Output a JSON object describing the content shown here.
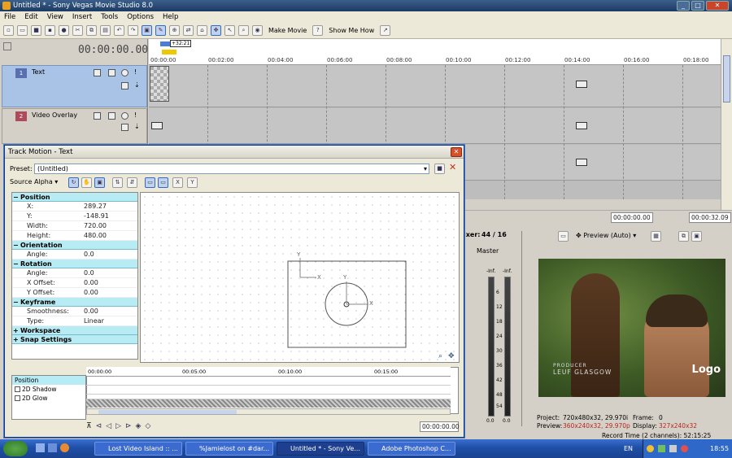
{
  "window": {
    "title": "Untitled * - Sony Vegas Movie Studio 8.0"
  },
  "menu": [
    "File",
    "Edit",
    "View",
    "Insert",
    "Tools",
    "Options",
    "Help"
  ],
  "toolbar": {
    "make_movie": "Make Movie",
    "show_me_how": "Show Me How"
  },
  "timeline": {
    "current_time": "00:00:00.00",
    "loop_marker": "+32:21",
    "ruler_ticks": [
      "00:00:00",
      "00:02:00",
      "00:04:00",
      "00:06:00",
      "00:08:00",
      "00:10:00",
      "00:12:00",
      "00:14:00",
      "00:16:00",
      "00:18:00"
    ],
    "tracks": [
      {
        "number": "1",
        "name": "Text"
      },
      {
        "number": "2",
        "name": "Video Overlay"
      }
    ],
    "status_start": "00:00:00.00",
    "status_end": "00:00:32.09"
  },
  "mixer": {
    "label": "ixer:",
    "ratio": "44 / 16",
    "master": "Master",
    "inf_left": "-Inf.",
    "inf_right": "-Inf.",
    "scale": [
      "6",
      "12",
      "18",
      "24",
      "30",
      "36",
      "42",
      "48",
      "54"
    ],
    "bottom_left": "0.0",
    "bottom_right": "0.0"
  },
  "preview": {
    "mode": "Preview (Auto)",
    "overlay_logo": "Logo",
    "credit_line1": "PRODUCER",
    "credit_line2": "LEUF GLASGOW",
    "project_label": "Project:",
    "project_value": "720x480x32, 29.970i",
    "preview_label": "Preview:",
    "preview_value": "360x240x32, 29.970p",
    "frame_label": "Frame:",
    "frame_value": "0",
    "display_label": "Display:",
    "display_value": "327x240x32",
    "record_time": "Record Time (2 channels): 52:15:25"
  },
  "dialog": {
    "title": "Track Motion - Text",
    "preset_label": "Preset:",
    "preset_value": "(Untitled)",
    "source_alpha": "Source Alpha",
    "sections": {
      "position": "Position",
      "orientation": "Orientation",
      "rotation": "Rotation",
      "keyframe": "Keyframe",
      "workspace": "Workspace",
      "snap": "Snap Settings"
    },
    "position": [
      {
        "k": "X:",
        "v": "289.27"
      },
      {
        "k": "Y:",
        "v": "-148.91"
      },
      {
        "k": "Width:",
        "v": "720.00"
      },
      {
        "k": "Height:",
        "v": "480.00"
      }
    ],
    "orientation": [
      {
        "k": "Angle:",
        "v": "0.0"
      }
    ],
    "rotation": [
      {
        "k": "Angle:",
        "v": "0.0"
      },
      {
        "k": "X Offset:",
        "v": "0.00"
      },
      {
        "k": "Y Offset:",
        "v": "0.00"
      }
    ],
    "keyframe": [
      {
        "k": "Smoothness:",
        "v": "0.00"
      },
      {
        "k": "Type:",
        "v": "Linear"
      }
    ],
    "canvas_x_label": "X",
    "canvas_y_label": "Y",
    "kf_tracks": [
      "Position",
      "2D Shadow",
      "2D Glow"
    ],
    "kf_ticks": [
      "00:00:00",
      "00:05:00",
      "00:10:00",
      "00:15:00"
    ],
    "kf_time": "00:00:00.00"
  },
  "taskbar": {
    "items": [
      "Lost Video Island :: ...",
      "%Jamielost on #dar...",
      "Untitled * - Sony Ve...",
      "Adobe Photoshop C..."
    ],
    "lang": "EN",
    "clock": "18:55"
  }
}
